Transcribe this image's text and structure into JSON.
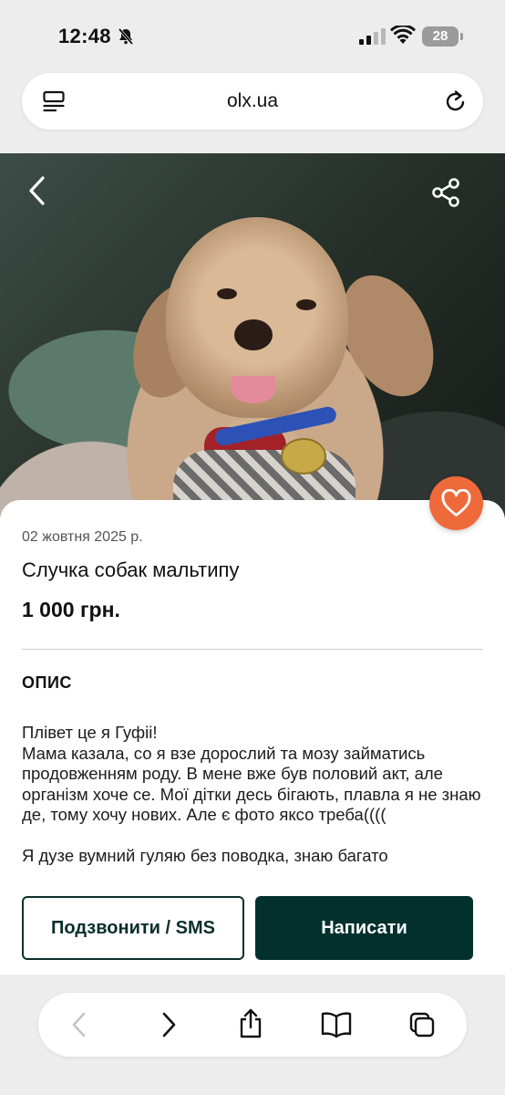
{
  "status_bar": {
    "time": "12:48",
    "battery": "28"
  },
  "browser": {
    "url": "olx.ua"
  },
  "listing": {
    "date": "02 жовтня 2025 р.",
    "title": "Случка собак мальтипу",
    "price": "1 000 грн.",
    "section_heading": "ОПИС",
    "description": {
      "p1": "Плівет це я Гуфіі!",
      "p2": "Мама казала, со я взе дорослий та мозу займатись продовженням роду. В мене вже був половий акт, але організм хоче се. Мої дітки десь бігають, плавла я не знаю де, тому хочу нових. Але є фото яксо треба((((",
      "p3": "Я дузе вумний гуляю без поводка, знаю багато"
    }
  },
  "actions": {
    "call_label": "Подзвонити / SMS",
    "write_label": "Написати"
  },
  "colors": {
    "fav": "#ef6a3b",
    "primary": "#02302d"
  },
  "icons": [
    "bell-off-icon",
    "signal-icon",
    "wifi-icon",
    "menu-icon",
    "reload-icon",
    "back-icon",
    "share-icon",
    "heart-icon",
    "chevron-left-icon",
    "chevron-right-icon",
    "share-upload-icon",
    "book-icon",
    "tabs-icon"
  ]
}
